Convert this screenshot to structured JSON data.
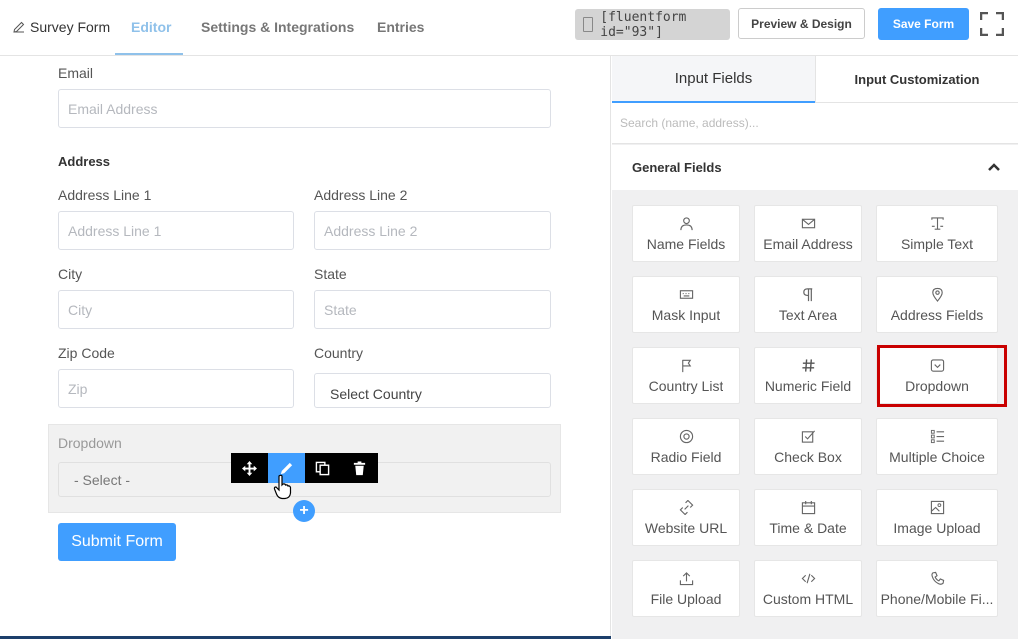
{
  "header": {
    "brand_label": "Survey Form",
    "tabs": [
      {
        "label": "Editor",
        "active": true
      },
      {
        "label": "Settings & Integrations",
        "active": false
      },
      {
        "label": "Entries",
        "active": false
      }
    ],
    "shortcode": "[fluentform id=\"93\"]",
    "preview_label": "Preview & Design",
    "save_label": "Save Form"
  },
  "form": {
    "email": {
      "label": "Email",
      "placeholder": "Email Address"
    },
    "address": {
      "title": "Address",
      "line1": {
        "label": "Address Line 1",
        "placeholder": "Address Line 1"
      },
      "line2": {
        "label": "Address Line 2",
        "placeholder": "Address Line 2"
      },
      "city": {
        "label": "City",
        "placeholder": "City"
      },
      "state": {
        "label": "State",
        "placeholder": "State"
      },
      "zip": {
        "label": "Zip Code",
        "placeholder": "Zip"
      },
      "country": {
        "label": "Country",
        "value": "Select Country"
      }
    },
    "dropdown": {
      "label": "Dropdown",
      "value": "- Select -"
    },
    "submit_label": "Submit Form",
    "add_symbol": "+"
  },
  "panel": {
    "tabs": [
      {
        "label": "Input Fields",
        "active": true
      },
      {
        "label": "Input Customization",
        "active": false
      }
    ],
    "search_placeholder": "Search (name, address)...",
    "section_title": "General Fields",
    "fields": [
      {
        "label": "Name Fields",
        "icon": "user-icon"
      },
      {
        "label": "Email Address",
        "icon": "envelope-icon"
      },
      {
        "label": "Simple Text",
        "icon": "text-cursor-icon"
      },
      {
        "label": "Mask Input",
        "icon": "keyboard-icon"
      },
      {
        "label": "Text Area",
        "icon": "paragraph-icon"
      },
      {
        "label": "Address Fields",
        "icon": "map-pin-icon"
      },
      {
        "label": "Country List",
        "icon": "flag-icon"
      },
      {
        "label": "Numeric Field",
        "icon": "hash-icon"
      },
      {
        "label": "Dropdown",
        "icon": "dropdown-icon"
      },
      {
        "label": "Radio Field",
        "icon": "radio-icon"
      },
      {
        "label": "Check Box",
        "icon": "checkbox-icon"
      },
      {
        "label": "Multiple Choice",
        "icon": "list-icon"
      },
      {
        "label": "Website URL",
        "icon": "link-icon"
      },
      {
        "label": "Time & Date",
        "icon": "calendar-icon"
      },
      {
        "label": "Image Upload",
        "icon": "image-icon"
      },
      {
        "label": "File Upload",
        "icon": "upload-icon"
      },
      {
        "label": "Custom HTML",
        "icon": "code-icon"
      },
      {
        "label": "Phone/Mobile Fi...",
        "icon": "phone-icon"
      }
    ]
  },
  "colors": {
    "primary": "#409eff",
    "highlight": "#c90000",
    "active_tab": "#8fc1ea"
  }
}
